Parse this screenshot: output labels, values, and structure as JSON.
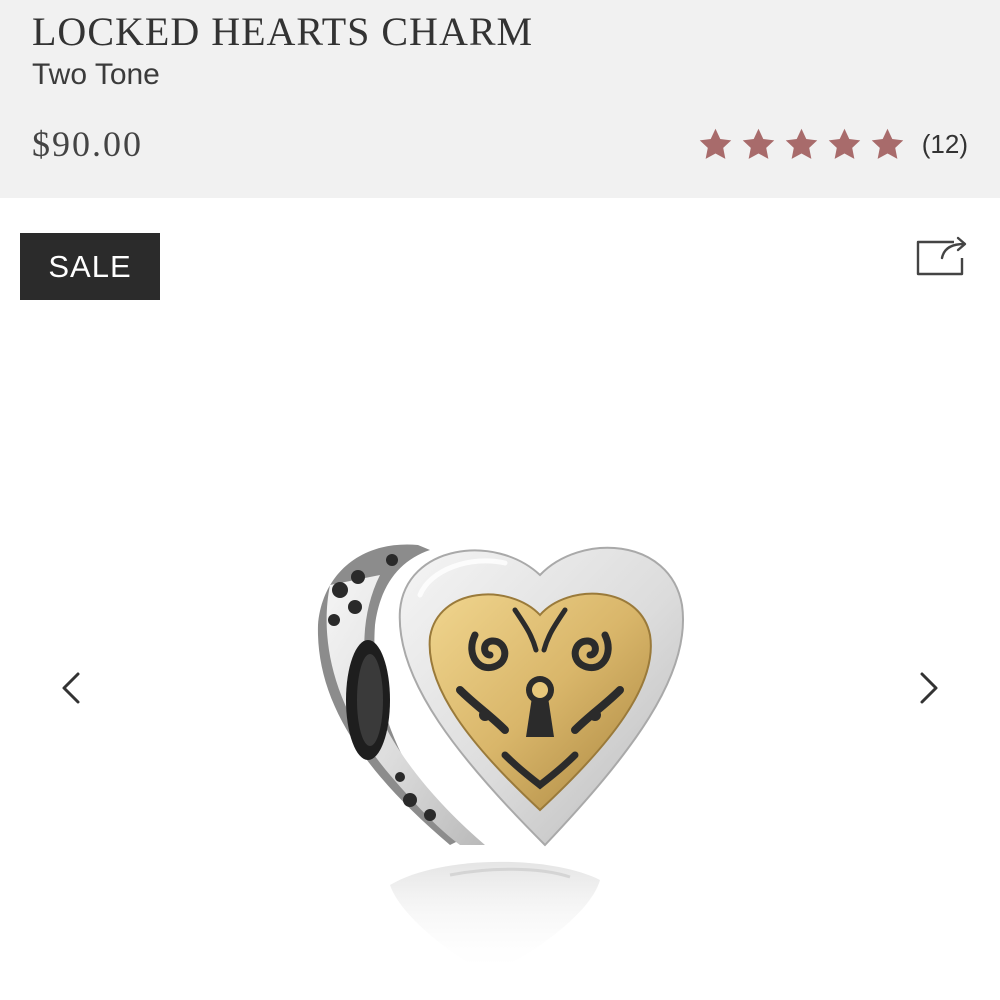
{
  "product": {
    "title": "LOCKED HEARTS CHARM",
    "variant": "Two Tone",
    "price": "$90.00",
    "rating": {
      "value": 5,
      "max": 5,
      "count_label": "(12)",
      "star_color": "#a86b6b"
    },
    "badge": "SALE",
    "image": {
      "icon": "heart-charm-image"
    }
  },
  "controls": {
    "share_icon": "share-icon",
    "prev_icon": "chevron-left-icon",
    "next_icon": "chevron-right-icon"
  },
  "colors": {
    "header_bg": "#f1f1f1",
    "badge_bg": "#2b2b2b",
    "gold": "#d9b66a",
    "silver": "#e9e9e9"
  }
}
